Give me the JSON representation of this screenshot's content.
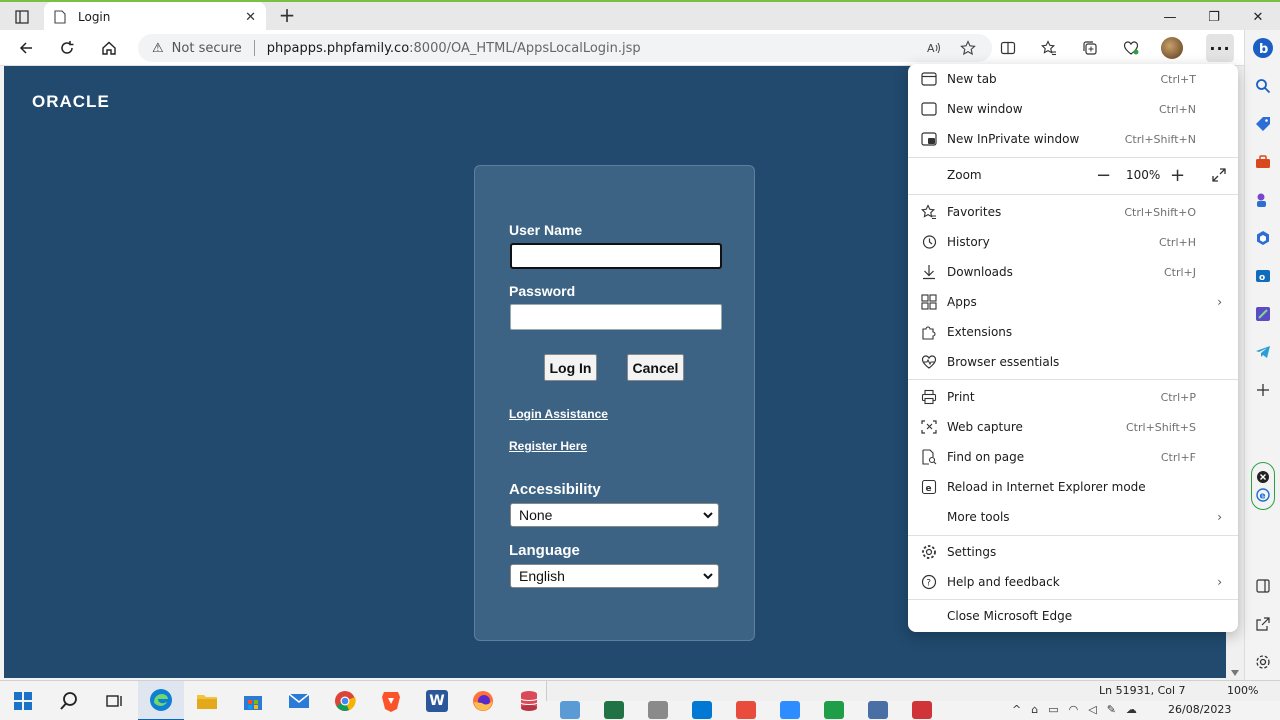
{
  "browser": {
    "tab_title": "Login",
    "address": {
      "security_label": "Not secure",
      "host": "phpapps.phpfamily.co",
      "path": ":8000/OA_HTML/AppsLocalLogin.jsp"
    }
  },
  "page": {
    "logo_text": "ORACLE",
    "form": {
      "username_label": "User Name",
      "password_label": "Password",
      "login_button": "Log In",
      "cancel_button": "Cancel",
      "login_assistance_link": "Login Assistance",
      "register_link": "Register Here",
      "accessibility_label": "Accessibility",
      "accessibility_value": "None",
      "language_label": "Language",
      "language_value": "English"
    }
  },
  "menu": {
    "items": [
      {
        "label": "New tab",
        "shortcut": "Ctrl+T"
      },
      {
        "label": "New window",
        "shortcut": "Ctrl+N"
      },
      {
        "label": "New InPrivate window",
        "shortcut": "Ctrl+Shift+N"
      }
    ],
    "zoom_label": "Zoom",
    "zoom_value": "100%",
    "items2": [
      {
        "label": "Favorites",
        "shortcut": "Ctrl+Shift+O"
      },
      {
        "label": "History",
        "shortcut": "Ctrl+H"
      },
      {
        "label": "Downloads",
        "shortcut": "Ctrl+J"
      },
      {
        "label": "Apps",
        "shortcut": ""
      },
      {
        "label": "Extensions",
        "shortcut": ""
      },
      {
        "label": "Browser essentials",
        "shortcut": ""
      }
    ],
    "items3": [
      {
        "label": "Print",
        "shortcut": "Ctrl+P"
      },
      {
        "label": "Web capture",
        "shortcut": "Ctrl+Shift+S"
      },
      {
        "label": "Find on page",
        "shortcut": "Ctrl+F"
      },
      {
        "label": "Reload in Internet Explorer mode",
        "shortcut": ""
      },
      {
        "label": "More tools",
        "shortcut": ""
      }
    ],
    "items4": [
      {
        "label": "Settings"
      },
      {
        "label": "Help and feedback"
      }
    ],
    "close_label": "Close Microsoft Edge"
  },
  "taskbar": {
    "status_position": "Ln 51931, Col 7",
    "status_zoom": "100%",
    "date": "26/08/2023"
  },
  "colors": {
    "page_bg": "#214a6e",
    "login_box_bg": "#3c6384",
    "tab_accent": "#7ac143"
  }
}
